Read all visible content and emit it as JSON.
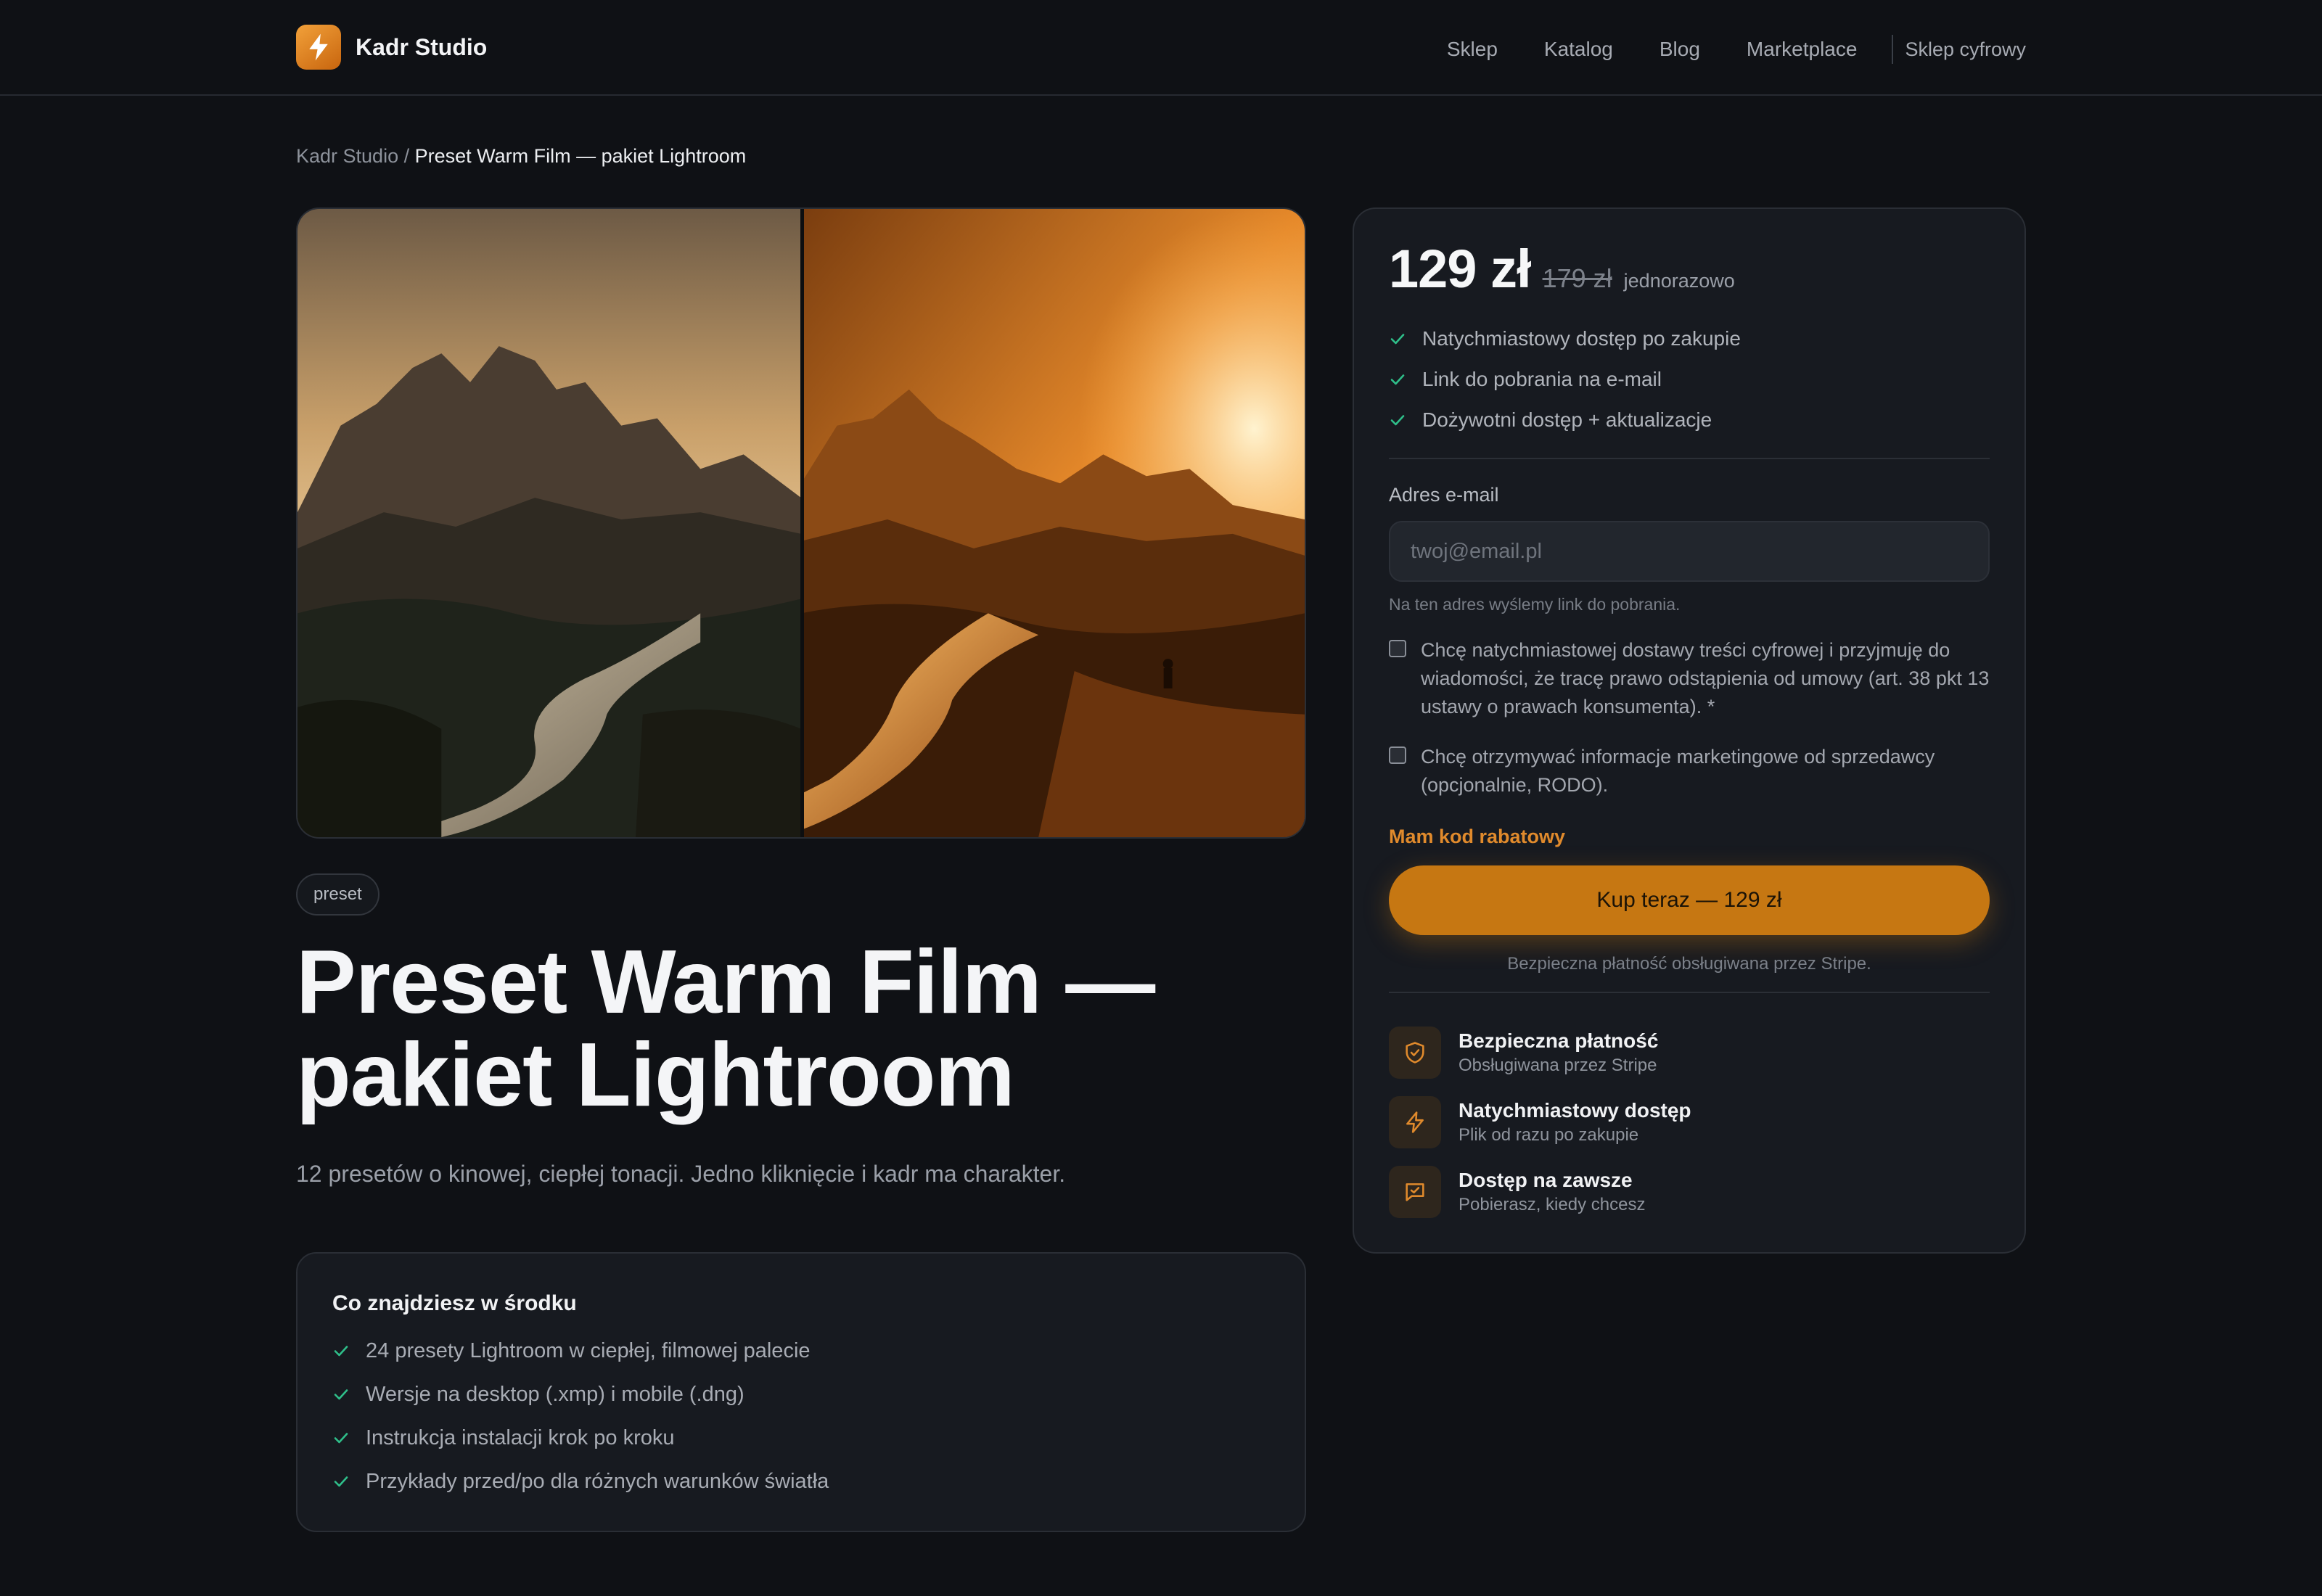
{
  "header": {
    "brand": "Kadr Studio",
    "nav": [
      "Sklep",
      "Katalog",
      "Blog",
      "Marketplace"
    ],
    "shop_link": "Sklep cyfrowy"
  },
  "breadcrumb": {
    "root": "Kadr Studio",
    "separator": " / ",
    "current": "Preset Warm Film — pakiet Lightroom"
  },
  "product": {
    "tag": "preset",
    "title_line1": "Preset Warm Film —",
    "title_line2": "pakiet Lightroom",
    "subtitle": "12 presetów o kinowej, ciepłej tonacji. Jedno kliknięcie i kadr ma charakter.",
    "contents_title": "Co znajdziesz w środku",
    "contents": [
      "24 presety Lightroom w ciepłej, filmowej palecie",
      "Wersje na desktop (.xmp) i mobile (.dng)",
      "Instrukcja instalacji krok po kroku",
      "Przykłady przed/po dla różnych warunków światła"
    ]
  },
  "purchase": {
    "price": "129 zł",
    "old_price": "179 zł",
    "price_note": "jednorazowo",
    "perks": [
      "Natychmiastowy dostęp po zakupie",
      "Link do pobrania na e-mail",
      "Dożywotni dostęp + aktualizacje"
    ],
    "email_label": "Adres e-mail",
    "email_placeholder": "twoj@email.pl",
    "email_hint": "Na ten adres wyślemy link do pobrania.",
    "consent_digital": "Chcę natychmiastowej dostawy treści cyfrowej i przyjmuję do wiadomości, że tracę prawo odstąpienia od umowy (art. 38 pkt 13 ustawy o prawach konsumenta). *",
    "consent_marketing": "Chcę otrzymywać informacje marketingowe od sprzedawcy (opcjonalnie, RODO).",
    "discount_link": "Mam kod rabatowy",
    "buy_button": "Kup teraz — 129 zł",
    "secure_note": "Bezpieczna płatność obsługiwana przez Stripe.",
    "features": [
      {
        "title": "Bezpieczna płatność",
        "subtitle": "Obsługiwana przez Stripe",
        "icon": "shield-icon"
      },
      {
        "title": "Natychmiastowy dostęp",
        "subtitle": "Plik od razu po zakupie",
        "icon": "bolt-icon"
      },
      {
        "title": "Dostęp na zawsze",
        "subtitle": "Pobierasz, kiedy chcesz",
        "icon": "message-icon"
      }
    ]
  },
  "colors": {
    "background": "#0f1115",
    "card": "#171a20",
    "accent": "#c67712",
    "accent_text": "#e08a2c",
    "check": "#2fbf8a"
  }
}
